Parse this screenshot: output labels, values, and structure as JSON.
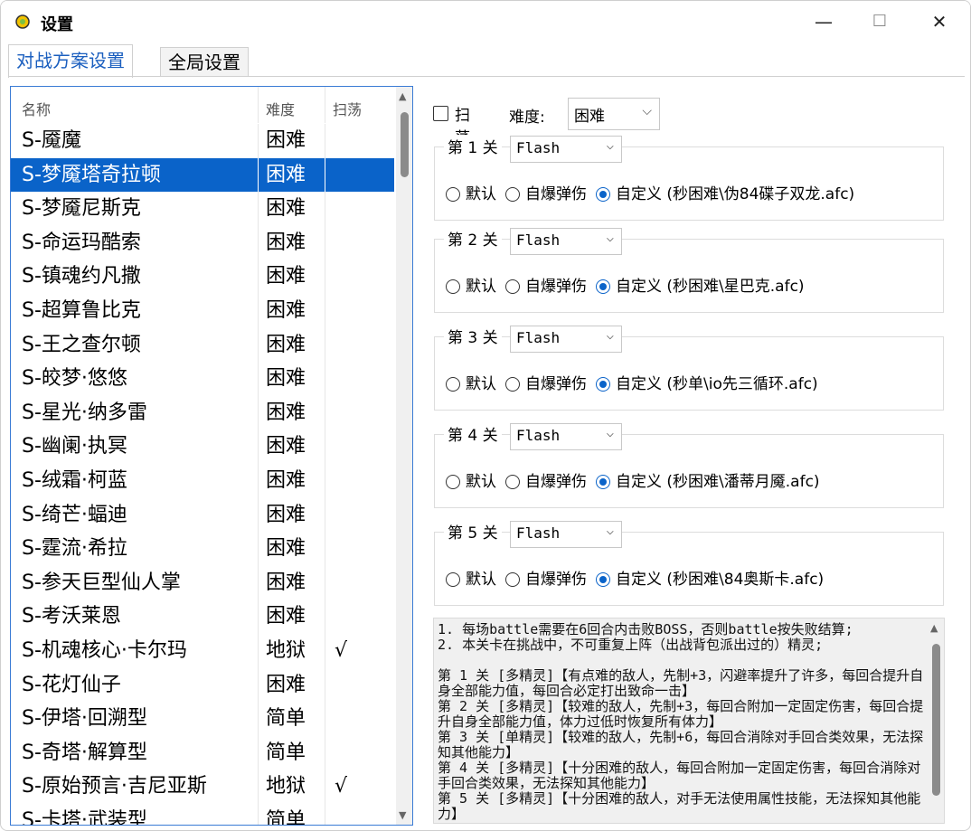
{
  "window": {
    "title": "设置",
    "controls": {
      "minimize": "—",
      "maximize": "☐",
      "close": "✕"
    }
  },
  "tabs": [
    {
      "label": "对战方案设置",
      "active": true
    },
    {
      "label": "全局设置",
      "active": false
    }
  ],
  "list": {
    "columns": [
      "名称",
      "难度",
      "扫荡"
    ],
    "rows": [
      {
        "name": "S-魇魔",
        "difficulty": "困难",
        "sweep": ""
      },
      {
        "name": "S-梦魇塔奇拉顿",
        "difficulty": "困难",
        "sweep": ""
      },
      {
        "name": "S-梦魇尼斯克",
        "difficulty": "困难",
        "sweep": ""
      },
      {
        "name": "S-命运玛酷索",
        "difficulty": "困难",
        "sweep": ""
      },
      {
        "name": "S-镇魂约凡撒",
        "difficulty": "困难",
        "sweep": ""
      },
      {
        "name": "S-超算鲁比克",
        "difficulty": "困难",
        "sweep": ""
      },
      {
        "name": "S-王之查尔顿",
        "difficulty": "困难",
        "sweep": ""
      },
      {
        "name": "S-皎梦·悠悠",
        "difficulty": "困难",
        "sweep": ""
      },
      {
        "name": "S-星光·纳多雷",
        "difficulty": "困难",
        "sweep": ""
      },
      {
        "name": "S-幽阑·执冥",
        "difficulty": "困难",
        "sweep": ""
      },
      {
        "name": "S-绒霜·柯蓝",
        "difficulty": "困难",
        "sweep": ""
      },
      {
        "name": "S-绮芒·蝠迪",
        "difficulty": "困难",
        "sweep": ""
      },
      {
        "name": "S-霆流·希拉",
        "difficulty": "困难",
        "sweep": ""
      },
      {
        "name": "S-参天巨型仙人掌",
        "difficulty": "困难",
        "sweep": ""
      },
      {
        "name": "S-考沃莱恩",
        "difficulty": "困难",
        "sweep": ""
      },
      {
        "name": "S-机魂核心·卡尔玛",
        "difficulty": "地狱",
        "sweep": "√"
      },
      {
        "name": "S-花灯仙子",
        "difficulty": "困难",
        "sweep": ""
      },
      {
        "name": "S-伊塔·回溯型",
        "difficulty": "简单",
        "sweep": ""
      },
      {
        "name": "S-奇塔·解算型",
        "difficulty": "简单",
        "sweep": ""
      },
      {
        "name": "S-原始预言·吉尼亚斯",
        "difficulty": "地狱",
        "sweep": "√"
      },
      {
        "name": "S-卡塔·武装型",
        "difficulty": "简单",
        "sweep": ""
      }
    ],
    "selected_index": 1
  },
  "settings": {
    "sweep_label": "扫荡",
    "sweep_checked": false,
    "difficulty_label": "难度:",
    "difficulty_value": "困难",
    "stages": [
      {
        "label": "第 1 关",
        "mode": "Flash",
        "options": [
          "默认",
          "自爆弹伤",
          "自定义 (秒困难\\伪84碟子双龙.afc)"
        ],
        "selected": 2
      },
      {
        "label": "第 2 关",
        "mode": "Flash",
        "options": [
          "默认",
          "自爆弹伤",
          "自定义 (秒困难\\星巴克.afc)"
        ],
        "selected": 2
      },
      {
        "label": "第 3 关",
        "mode": "Flash",
        "options": [
          "默认",
          "自爆弹伤",
          "自定义 (秒单\\io先三循环.afc)"
        ],
        "selected": 2
      },
      {
        "label": "第 4 关",
        "mode": "Flash",
        "options": [
          "默认",
          "自爆弹伤",
          "自定义 (秒困难\\潘蒂月魇.afc)"
        ],
        "selected": 2
      },
      {
        "label": "第 5 关",
        "mode": "Flash",
        "options": [
          "默认",
          "自爆弹伤",
          "自定义 (秒困难\\84奥斯卡.afc)"
        ],
        "selected": 2
      }
    ]
  },
  "notes": "1. 每场battle需要在6回合内击败BOSS，否则battle按失败结算;\n2. 本关卡在挑战中，不可重复上阵（出战背包派出过的）精灵;\n\n第 1 关 [多精灵]【有点难的敌人，先制+3，闪避率提升了许多，每回合提升自身全部能力值，每回合必定打出致命一击】\n第 2 关 [多精灵]【较难的敌人，先制+3，每回合附加一定固定伤害，每回合提升自身全部能力值，体力过低时恢复所有体力】\n第 3 关 [单精灵]【较难的敌人，先制+6，每回合消除对手回合类效果，无法探知其他能力】\n第 4 关 [多精灵]【十分困难的敌人，每回合附加一定固定伤害，每回合消除对手回合类效果，无法探知其他能力】\n第 5 关 [多精灵]【十分困难的敌人，对手无法使用属性技能，无法探知其他能力】"
}
